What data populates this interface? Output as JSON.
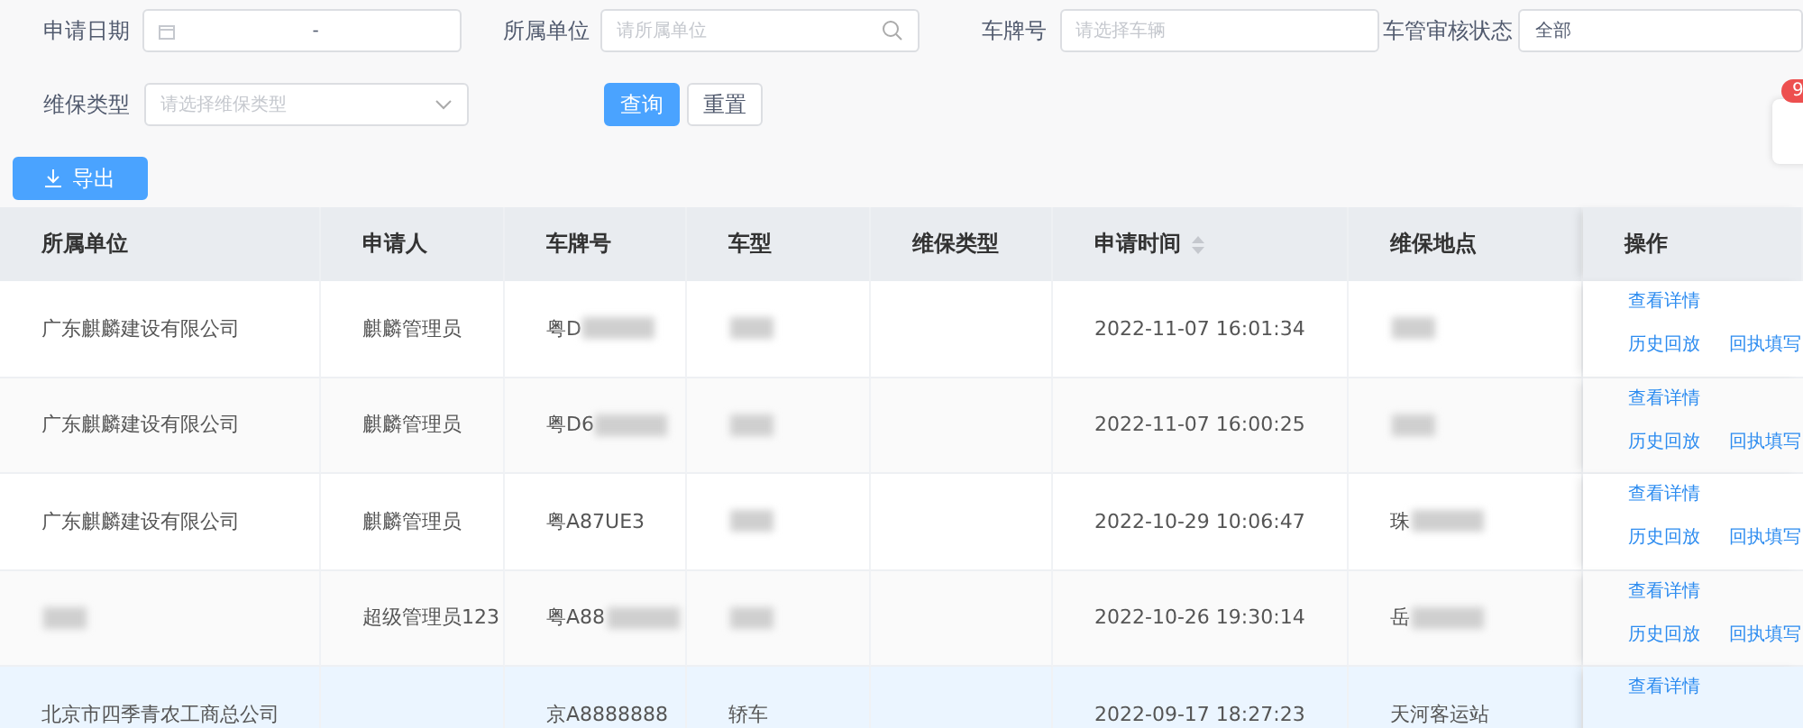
{
  "filters": [
    {
      "label": "申请日期",
      "kind": "date",
      "value": "-"
    },
    {
      "label": "所属单位",
      "kind": "search",
      "placeholder": "请所属单位"
    },
    {
      "label": "车牌号",
      "kind": "text",
      "placeholder": "请选择车辆"
    },
    {
      "label": "车管审核状态",
      "kind": "select_plain",
      "value": "全部"
    },
    {
      "label": "维保类型",
      "kind": "select",
      "placeholder": "请选择维保类型"
    }
  ],
  "query_button": "查询",
  "reset_button": "重置",
  "export_button": "导出",
  "notification_badge": "9",
  "table": {
    "columns": [
      {
        "label": "所属单位",
        "sortable": false
      },
      {
        "label": "申请人",
        "sortable": false
      },
      {
        "label": "车牌号",
        "sortable": false
      },
      {
        "label": "车型",
        "sortable": false
      },
      {
        "label": "维保类型",
        "sortable": false
      },
      {
        "label": "申请时间",
        "sortable": true
      },
      {
        "label": "维保地点",
        "sortable": false
      },
      {
        "label": "操作",
        "sortable": false
      }
    ],
    "rows": [
      {
        "selected": false,
        "cells": [
          {
            "text": "广东麒麟建设有限公司",
            "blurred": false
          },
          {
            "text": "麒麟管理员",
            "blurred": false
          },
          {
            "text": "粤D",
            "blurred": true
          },
          {
            "blurred": true
          },
          {
            "blurred": false
          },
          {
            "text": "2022-11-07 16:01:34",
            "blurred": false
          },
          {
            "blurred": true
          }
        ],
        "actions": [
          "查看详情",
          "历史回放",
          "回执填写"
        ]
      },
      {
        "selected": false,
        "cells": [
          {
            "text": "广东麒麟建设有限公司",
            "blurred": false
          },
          {
            "text": "麒麟管理员",
            "blurred": false
          },
          {
            "text": "粤D6",
            "blurred": true
          },
          {
            "blurred": true
          },
          {
            "blurred": false
          },
          {
            "text": "2022-11-07 16:00:25",
            "blurred": false
          },
          {
            "blurred": true
          }
        ],
        "actions": [
          "查看详情",
          "历史回放",
          "回执填写"
        ]
      },
      {
        "selected": false,
        "cells": [
          {
            "text": "广东麒麟建设有限公司",
            "blurred": false
          },
          {
            "text": "麒麟管理员",
            "blurred": false
          },
          {
            "text": "粤A87UE3",
            "blurred": false
          },
          {
            "blurred": true
          },
          {
            "blurred": false
          },
          {
            "text": "2022-10-29 10:06:47",
            "blurred": false
          },
          {
            "text": "珠",
            "blurred": true
          }
        ],
        "actions": [
          "查看详情",
          "历史回放",
          "回执填写"
        ]
      },
      {
        "selected": false,
        "cells": [
          {
            "blurred": true
          },
          {
            "text": "超级管理员123",
            "blurred": false
          },
          {
            "text": "粤A88",
            "blurred": true
          },
          {
            "blurred": true
          },
          {
            "blurred": false
          },
          {
            "text": "2022-10-26 19:30:14",
            "blurred": false
          },
          {
            "text": "岳",
            "blurred": true
          }
        ],
        "actions": [
          "查看详情",
          "历史回放",
          "回执填写"
        ]
      },
      {
        "selected": true,
        "cells": [
          {
            "text": "北京市四季青农工商总公司",
            "blurred": false
          },
          {
            "blurred": false
          },
          {
            "text": "京A8888888",
            "blurred": false
          },
          {
            "text": "轿车",
            "blurred": false
          },
          {
            "blurred": false
          },
          {
            "text": "2022-09-17 18:27:23",
            "blurred": false
          },
          {
            "text": "天河客运站",
            "blurred": false
          }
        ],
        "actions": [
          "查看详情"
        ]
      }
    ]
  }
}
